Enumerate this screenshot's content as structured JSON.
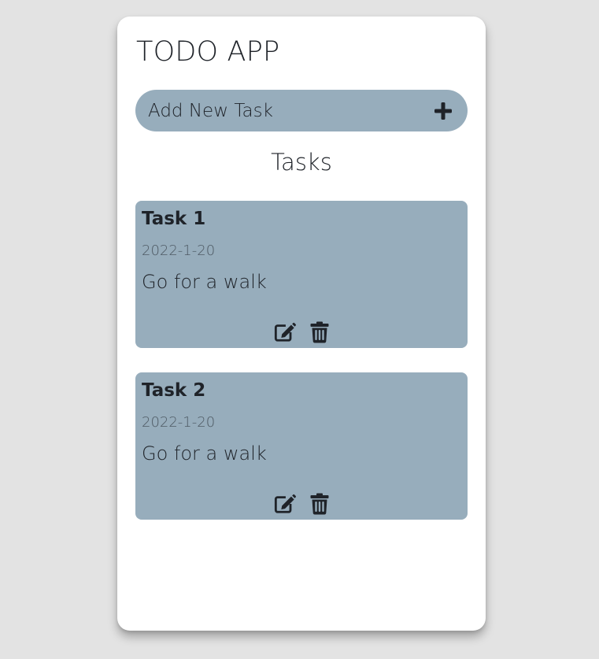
{
  "app": {
    "title": "TODO APP"
  },
  "add_task": {
    "label": "Add New Task",
    "icon": "plus-icon"
  },
  "tasks_section": {
    "title": "Tasks"
  },
  "tasks": [
    {
      "title": "Task 1",
      "date": "2022-1-20",
      "description": "Go for a walk",
      "actions": [
        "edit-icon",
        "trash-icon"
      ]
    },
    {
      "title": "Task 2",
      "date": "2022-1-20",
      "description": "Go for a walk",
      "actions": [
        "edit-icon",
        "trash-icon"
      ]
    }
  ],
  "colors": {
    "background": "#e3e3e3",
    "card": "#ffffff",
    "accent": "#97adbc",
    "text": "#1f2329"
  }
}
